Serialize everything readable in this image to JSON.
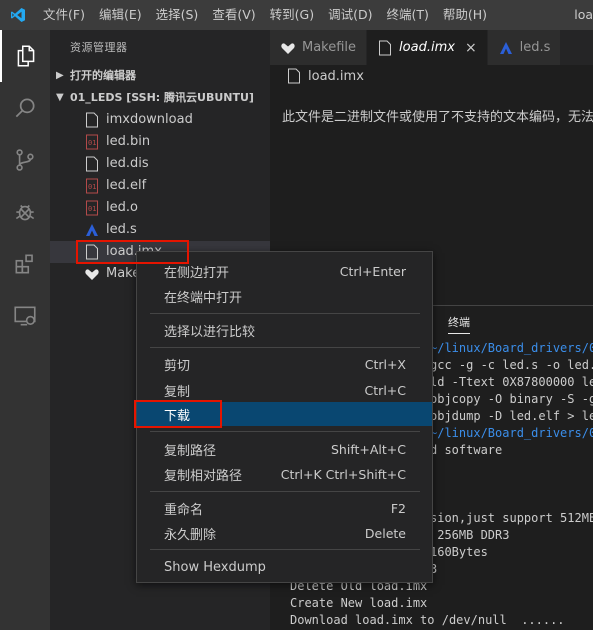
{
  "titlebar": {
    "menu": [
      "文件(F)",
      "编辑(E)",
      "选择(S)",
      "查看(V)",
      "转到(G)",
      "调试(D)",
      "终端(T)",
      "帮助(H)"
    ],
    "title": "loa"
  },
  "sidebar": {
    "title": "资源管理器",
    "open_editors": "打开的编辑器",
    "workspace": "01_LEDS [SSH: 腾讯云UBUNTU]",
    "files": [
      {
        "name": "imxdownload",
        "icon": "file-icon"
      },
      {
        "name": "led.bin",
        "icon": "binary-file-icon"
      },
      {
        "name": "led.dis",
        "icon": "file-icon"
      },
      {
        "name": "led.elf",
        "icon": "binary-file-icon"
      },
      {
        "name": "led.o",
        "icon": "binary-file-icon"
      },
      {
        "name": "led.s",
        "icon": "asm-icon"
      },
      {
        "name": "load.imx",
        "icon": "file-icon"
      },
      {
        "name": "Makefile",
        "icon": "makefile-icon"
      }
    ]
  },
  "tabs": [
    {
      "label": "Makefile",
      "icon": "makefile-icon"
    },
    {
      "label": "load.imx",
      "icon": "file-icon",
      "close": "×"
    },
    {
      "label": "led.s",
      "icon": "asm-icon"
    }
  ],
  "editor": {
    "breadcrumb": "load.imx",
    "message": "此文件是二进制文件或使用了不支持的文本编码，无法在编辑器中显示。"
  },
  "panel": {
    "tab_label": "终端",
    "lines": [
      {
        "text": "~/linux/Board_drivers/01",
        "path": true
      },
      {
        "text": "gcc -g -c led.s -o led.o",
        "path": false
      },
      {
        "text": "ld -Ttext 0X87800000 led",
        "path": false
      },
      {
        "text": "objcopy -O binary -S -g",
        "path": false
      },
      {
        "text": "objdump -D led.elf > led",
        "path": false
      },
      {
        "text": "~/linux/Board_drivers/01",
        "path": true
      },
      {
        "text": "d software",
        "path": false
      },
      {
        "text": "sion,just support 512MB",
        "path": false
      },
      {
        "text": " 256MB DDR3",
        "path": false
      },
      {
        "text": "160Bytes",
        "path": false
      },
      {
        "text": "3",
        "path": false
      },
      {
        "text": "Delete Old load.imx",
        "path": false
      },
      {
        "text": "Create New load.imx",
        "path": false
      },
      {
        "text": "Download load.imx to /dev/null  ......",
        "path": false
      }
    ]
  },
  "context_menu": {
    "items": [
      {
        "label": "在侧边打开",
        "shortcut": "Ctrl+Enter"
      },
      {
        "label": "在终端中打开",
        "shortcut": ""
      },
      {
        "label": "选择以进行比较",
        "shortcut": ""
      },
      {
        "label": "剪切",
        "shortcut": "Ctrl+X"
      },
      {
        "label": "复制",
        "shortcut": "Ctrl+C"
      },
      {
        "label": "下载",
        "shortcut": ""
      },
      {
        "label": "复制路径",
        "shortcut": "Shift+Alt+C"
      },
      {
        "label": "复制相对路径",
        "shortcut": "Ctrl+K Ctrl+Shift+C"
      },
      {
        "label": "重命名",
        "shortcut": "F2"
      },
      {
        "label": "永久删除",
        "shortcut": "Delete"
      },
      {
        "label": "Show Hexdump",
        "shortcut": ""
      }
    ]
  },
  "colors": {
    "accent": "#094771",
    "highlight_box": "#e51400",
    "terminal_path": "#3b8eea"
  }
}
